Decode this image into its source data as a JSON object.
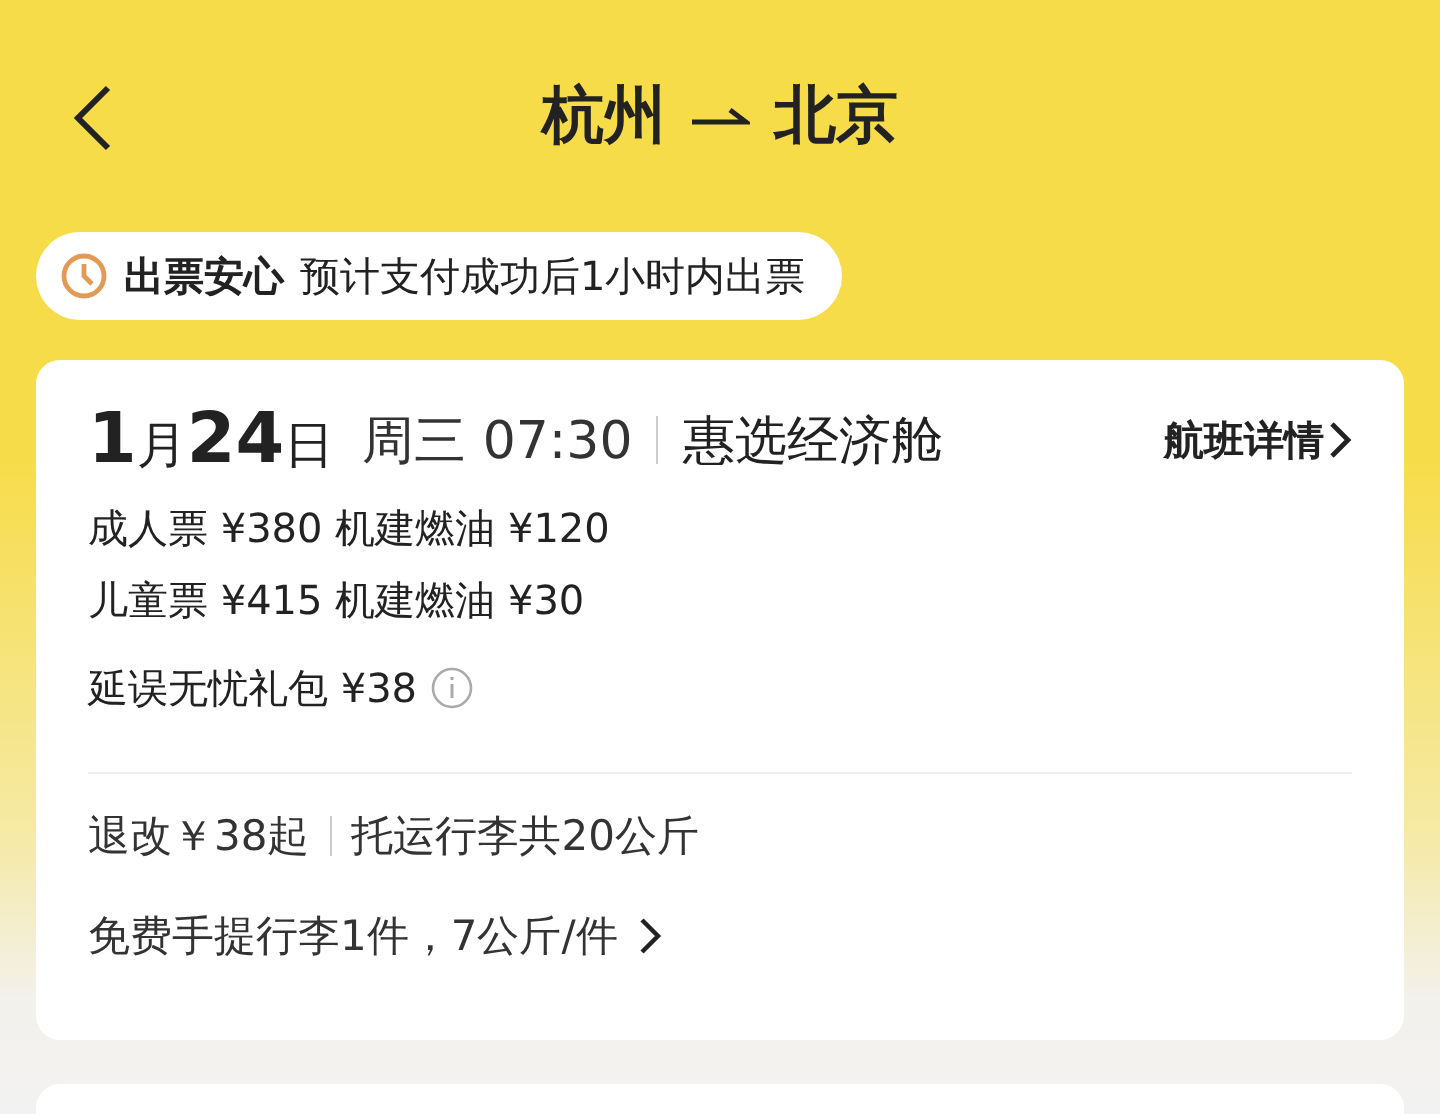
{
  "header": {
    "from": "杭州",
    "to": "北京"
  },
  "notice": {
    "title": "出票安心",
    "text": "预计支付成功后1小时内出票"
  },
  "flight": {
    "date": "**1**月**24**日",
    "weekday_time": "周三 07:30",
    "cabin": "惠选经济舱",
    "details_link": "航班详情"
  },
  "prices": [
    {
      "text": "成人票 ¥380 机建燃油 ¥120"
    },
    {
      "text": "儿童票 ¥415 机建燃油 ¥30"
    }
  ],
  "addon": "延误无忧礼包 ¥38",
  "policy": {
    "refund": "退改￥38起",
    "baggage": "托运行李共20公斤"
  },
  "carry_on": "免费手提行李1件，7公斤/件"
}
